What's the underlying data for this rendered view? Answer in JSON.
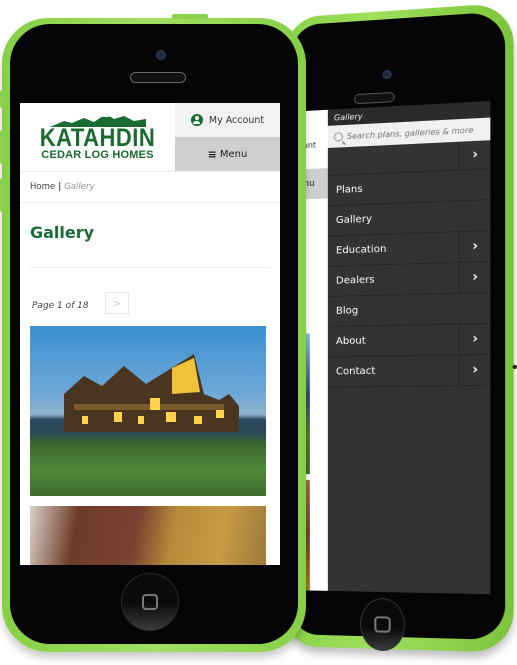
{
  "site": {
    "brand_line1": "KATAHDIN",
    "brand_line2": "CEDAR LOG HOMES",
    "brand_color": "#1a6b32"
  },
  "header": {
    "account_label": "My Account",
    "account_icon": "user-circle-icon",
    "menu_label": "Menu",
    "menu_icon": "hamburger-icon"
  },
  "breadcrumb": {
    "home": "Home",
    "separator": "|",
    "current": "Gallery"
  },
  "page": {
    "title": "Gallery",
    "pagination": {
      "text": "Page 1 of 18",
      "next_icon": "chevron-right-icon"
    },
    "photos": [
      {
        "alt": "Log home lit at dusk in meadow"
      },
      {
        "alt": "Red cedar log home among autumn trees"
      }
    ]
  },
  "nav_drawer": {
    "top_label": "Gallery",
    "peek_account": "ount",
    "peek_menu": "enu",
    "search_placeholder": "Search plans, galleries & more",
    "items": [
      {
        "label": "",
        "has_submenu": true
      },
      {
        "label": "Plans",
        "has_submenu": false
      },
      {
        "label": "Gallery",
        "has_submenu": false
      },
      {
        "label": "Education",
        "has_submenu": true
      },
      {
        "label": "Dealers",
        "has_submenu": true
      },
      {
        "label": "Blog",
        "has_submenu": false
      },
      {
        "label": "About",
        "has_submenu": true
      },
      {
        "label": "Contact",
        "has_submenu": true
      }
    ],
    "chevron": "›"
  },
  "colors": {
    "phone_case": "#9fe05b",
    "drawer_bg": "#333333"
  }
}
